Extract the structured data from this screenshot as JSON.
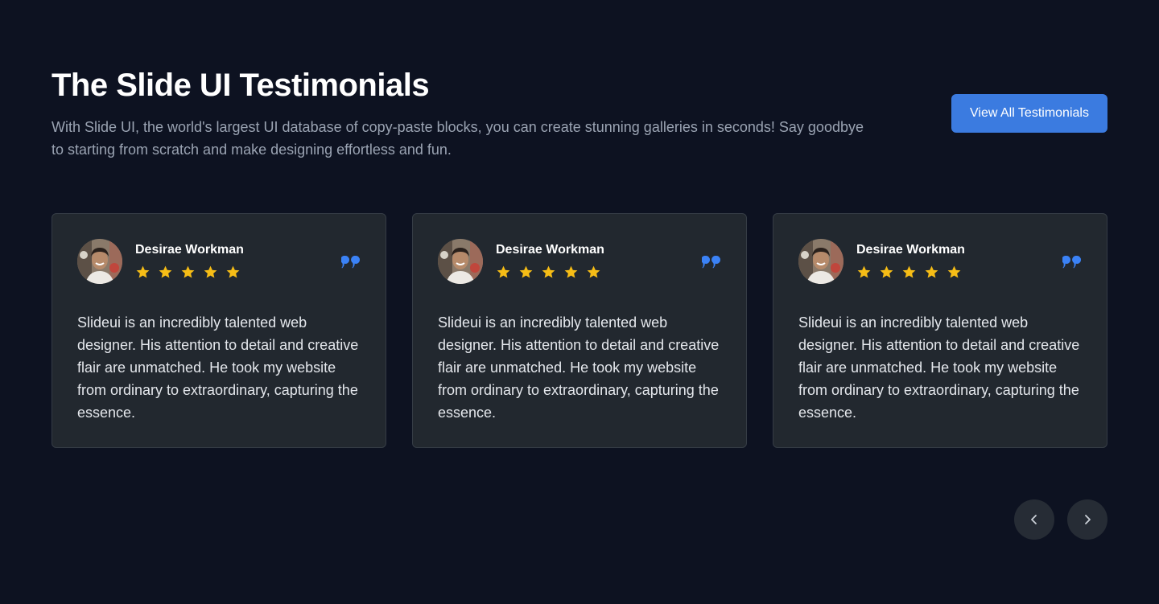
{
  "header": {
    "title": "The Slide UI Testimonials",
    "subtitle": "With Slide UI, the world's largest UI database of copy-paste blocks, you can create stunning galleries in seconds! Say goodbye to starting from scratch and make designing effortless and fun.",
    "view_all_label": "View All Testimonials"
  },
  "testimonials": [
    {
      "name": "Desirae Workman",
      "rating": 5,
      "text": "Slideui is an incredibly talented web designer. His attention to detail and creative flair are unmatched. He took my website from ordinary to extraordinary, capturing the essence."
    },
    {
      "name": "Desirae Workman",
      "rating": 5,
      "text": "Slideui is an incredibly talented web designer. His attention to detail and creative flair are unmatched. He took my website from ordinary to extraordinary, capturing the essence."
    },
    {
      "name": "Desirae Workman",
      "rating": 5,
      "text": "Slideui is an incredibly talented web designer. His attention to detail and creative flair are unmatched. He took my website from ordinary to extraordinary, capturing the essence."
    }
  ],
  "navigation": {
    "prev_icon": "chevron-left-icon",
    "next_icon": "chevron-right-icon"
  },
  "colors": {
    "background": "#0d1221",
    "card": "#22282f",
    "accent": "#3b7be0",
    "star": "#f6bd16",
    "quote": "#3b82f6"
  }
}
